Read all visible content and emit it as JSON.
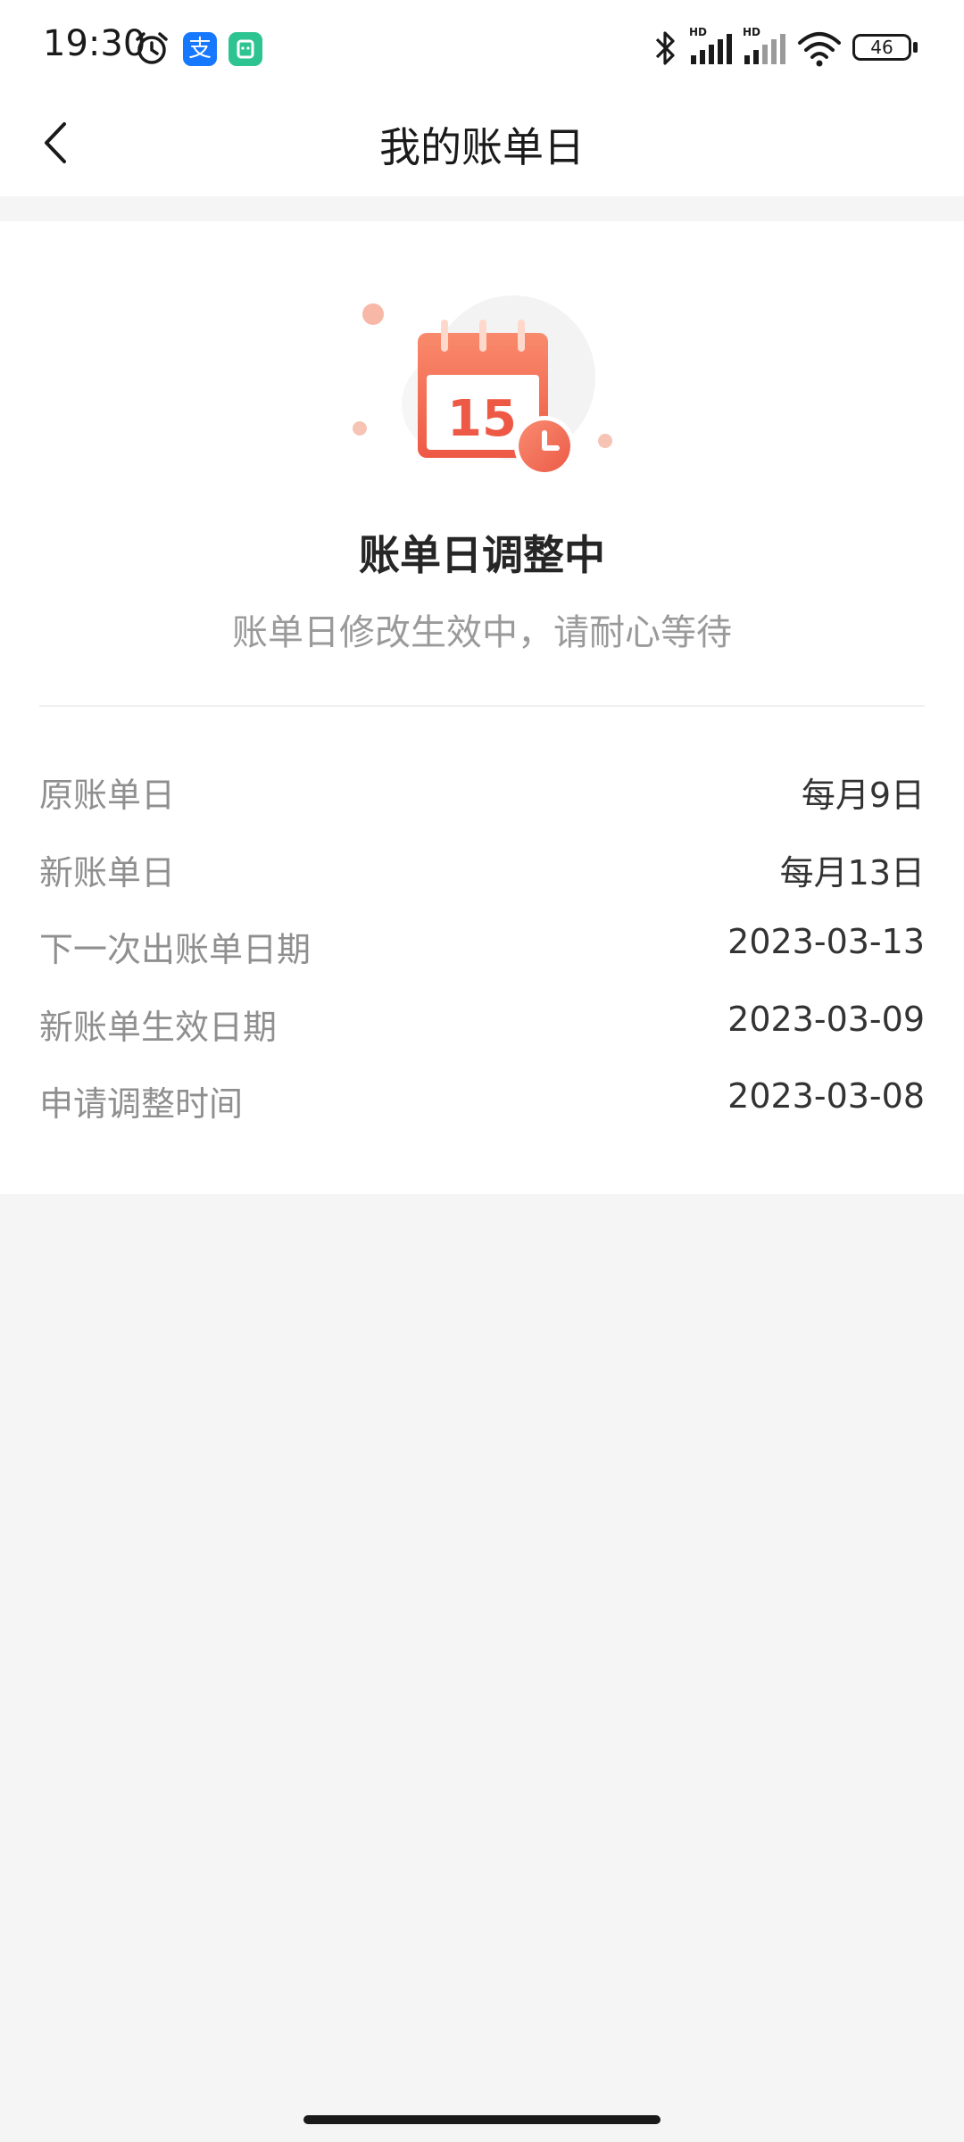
{
  "status_bar": {
    "time": "19:30",
    "battery": "46",
    "network_labels": [
      "HD",
      "HD"
    ]
  },
  "nav": {
    "title": "我的账单日",
    "back_icon": "chevron-left-icon"
  },
  "main": {
    "illustration_day": "15",
    "heading": "账单日调整中",
    "subheading": "账单日修改生效中，请耐心等待",
    "rows": [
      {
        "label": "原账单日",
        "value": "每月9日"
      },
      {
        "label": "新账单日",
        "value": "每月13日"
      },
      {
        "label": "下一次出账单日期",
        "value": "2023-03-13"
      },
      {
        "label": "新账单生效日期",
        "value": "2023-03-09"
      },
      {
        "label": "申请调整时间",
        "value": "2023-03-08"
      }
    ]
  },
  "colors": {
    "accent": "#f2614a",
    "background": "#f5f5f5",
    "label_gray": "#8f8f8f"
  }
}
